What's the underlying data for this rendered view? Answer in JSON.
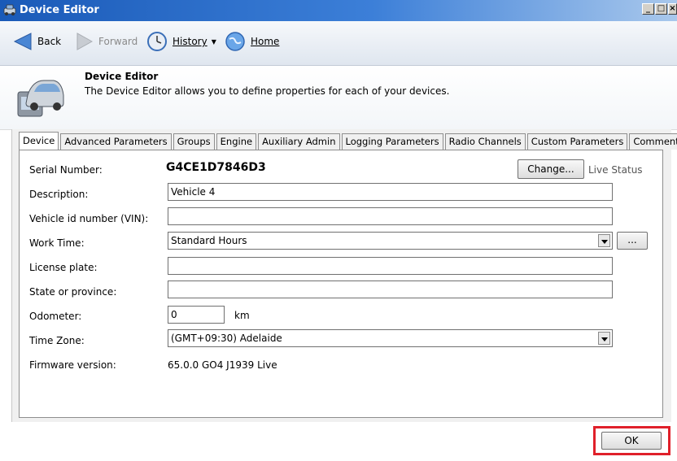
{
  "window": {
    "title": "Device Editor",
    "controls": {
      "minimize": "_",
      "maximize": "□",
      "close": "×"
    }
  },
  "nav": {
    "back": "Back",
    "forward": "Forward",
    "history": "History",
    "home": "Home"
  },
  "header": {
    "title": "Device Editor",
    "description": "The Device Editor allows you to define properties for each of your devices."
  },
  "tabs": [
    "Device",
    "Advanced Parameters",
    "Groups",
    "Engine",
    "Auxiliary Admin",
    "Logging Parameters",
    "Radio Channels",
    "Custom Parameters",
    "Comment"
  ],
  "active_tab": "Device",
  "form": {
    "serial_label": "Serial Number:",
    "serial_value": "G4CE1D7846D3",
    "change_button": "Change...",
    "live_status": "Live Status",
    "description_label": "Description:",
    "description_value": "Vehicle 4",
    "vin_label": "Vehicle id number (VIN):",
    "vin_value": "",
    "work_time_label": "Work Time:",
    "work_time_value": "Standard Hours",
    "ellipsis_button": "...",
    "license_label": "License plate:",
    "license_value": "",
    "state_label": "State or province:",
    "state_value": "",
    "odometer_label": "Odometer:",
    "odometer_value": "0",
    "odometer_unit": "km",
    "timezone_label": "Time Zone:",
    "timezone_value": "(GMT+09:30) Adelaide",
    "firmware_label": "Firmware version:",
    "firmware_value": "65.0.0 GO4 J1939 Live"
  },
  "ok_button": "OK",
  "colors": {
    "titlebar": "#1a5ab8",
    "highlight": "#e0202a"
  }
}
